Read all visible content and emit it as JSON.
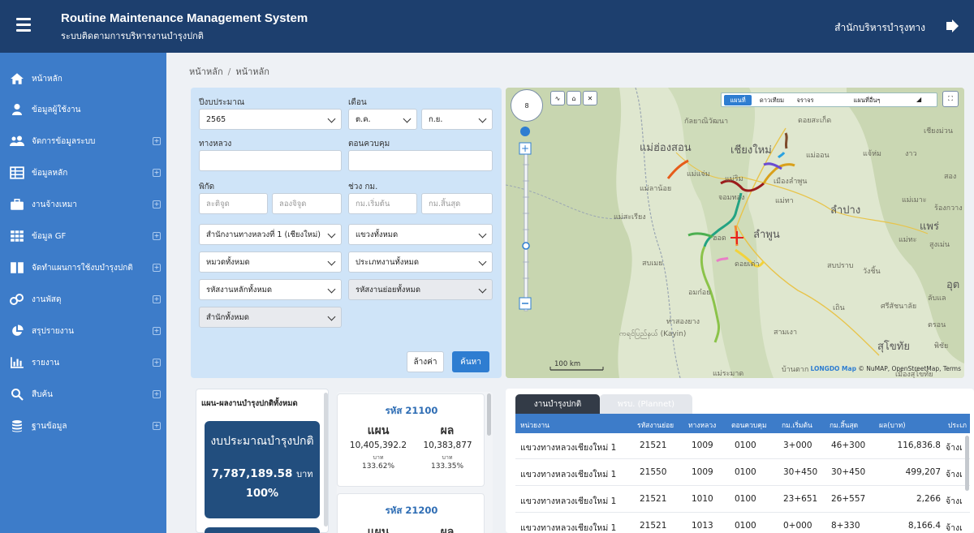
{
  "header": {
    "title": "Routine Maintenance Management System",
    "subtitle": "ระบบติดตามการบริหารงานบำรุงปกติ",
    "org": "สำนักบริหารบำรุงทาง"
  },
  "sidebar": {
    "items": [
      {
        "label": "หน้าหลัก",
        "icon": "home-icon",
        "expandable": false
      },
      {
        "label": "ข้อมูลผู้ใช้งาน",
        "icon": "user-icon",
        "expandable": false
      },
      {
        "label": "จัดการข้อมูลระบบ",
        "icon": "users-icon",
        "expandable": true
      },
      {
        "label": "ข้อมูลหลัก",
        "icon": "table-icon",
        "expandable": true
      },
      {
        "label": "งานจ้างเหมา",
        "icon": "briefcase-icon",
        "expandable": true
      },
      {
        "label": "ข้อมูล GF",
        "icon": "grid-icon",
        "expandable": true
      },
      {
        "label": "จัดทำแผนการใช้งบบำรุงปกติ",
        "icon": "columns-icon",
        "expandable": true
      },
      {
        "label": "งานพัสดุ",
        "icon": "cubes-icon",
        "expandable": true
      },
      {
        "label": "สรุปรายงาน",
        "icon": "pie-chart-icon",
        "expandable": true
      },
      {
        "label": "รายงาน",
        "icon": "bar-chart-icon",
        "expandable": true
      },
      {
        "label": "สืบค้น",
        "icon": "search-icon",
        "expandable": true
      },
      {
        "label": "ฐานข้อมูล",
        "icon": "database-icon",
        "expandable": true
      }
    ]
  },
  "breadcrumb": {
    "items": [
      "หน้าหลัก",
      "หน้าหลัก"
    ],
    "separator": "/"
  },
  "filters": {
    "fiscal_year_label": "ปีงบประมาณ",
    "fiscal_year_value": "2565",
    "month_label": "เดือน",
    "month_from": "ต.ค.",
    "month_to": "ก.ย.",
    "highway_label": "ทางหลวง",
    "highway_value": "",
    "control_label": "ตอนควบคุม",
    "control_value": "",
    "coord_label": "พิกัด",
    "lat_placeholder": "ละติจูด",
    "lon_placeholder": "ลองจิจูด",
    "km_label": "ช่วง กม.",
    "km_start_placeholder": "กม.เริ่มต้น",
    "km_end_placeholder": "กม.สิ้นสุด",
    "bureau": "สำนักงานทางหลวงที่ 1 (เชียงใหม่)",
    "district": "แขวงทั้งหมด",
    "unit": "หมวดทั้งหมด",
    "work_type": "ประเภทงานทั้งหมด",
    "main_code": "รหัสงานหลักทั้งหมด",
    "sub_code": "รหัสงานย่อยทั้งหมด",
    "office": "สำนักทั้งหมด",
    "clear_label": "ล้างค่า",
    "search_label": "ค้นหา"
  },
  "map": {
    "zoom_level": "8",
    "types": [
      "แผนที่",
      "ดาวเทียม",
      "จราจร",
      "แผนที่อื่นๆ"
    ],
    "active_type": "แผนที่",
    "scale": "100 km",
    "attribution_brand": "LONGDO Map",
    "attribution_rest": "© NuMAP, OpenStreetMap, Terms",
    "labels": [
      {
        "text": "กัลยาณิวัฒนา"
      },
      {
        "text": "ดอยสะเก็ด"
      },
      {
        "text": "เชียงม่วน"
      },
      {
        "text": "แม่ฮ่องสอน",
        "big": true
      },
      {
        "text": "เชียงใหม่",
        "big": true
      },
      {
        "text": "แม่ออน"
      },
      {
        "text": "แจ้ห่ม"
      },
      {
        "text": "งาว"
      },
      {
        "text": "แม่แจ่ม"
      },
      {
        "text": "เมืองลำพูน"
      },
      {
        "text": "สอง"
      },
      {
        "text": "แม่ลาน้อย"
      },
      {
        "text": "จอมทอง"
      },
      {
        "text": "แม่ทา"
      },
      {
        "text": "ลำปาง",
        "big": true
      },
      {
        "text": "แม่เมาะ"
      },
      {
        "text": "ร้องกวาง"
      },
      {
        "text": "แม่สะเรียง"
      },
      {
        "text": "แพร่",
        "big": true
      },
      {
        "text": "ฮอด"
      },
      {
        "text": "ลำพูน",
        "big": true
      },
      {
        "text": "แม่ทะ"
      },
      {
        "text": "สูงเม่น"
      },
      {
        "text": "สบเมย"
      },
      {
        "text": "ดอยเต่า"
      },
      {
        "text": "สบปราบ"
      },
      {
        "text": "วังชิ้น"
      },
      {
        "text": "อุต",
        "big": true
      },
      {
        "text": "อมก๋อย"
      },
      {
        "text": "เถิน"
      },
      {
        "text": "ศรีสัชนาลัย"
      },
      {
        "text": "ลับแล"
      },
      {
        "text": "ท่าสองยาง"
      },
      {
        "text": "สามเงา"
      },
      {
        "text": "ตรอน"
      },
      {
        "text": "ကရင်ပြည်နယ် (Kayin)"
      },
      {
        "text": "สุโขทัย",
        "big": true
      },
      {
        "text": "พิชัย"
      },
      {
        "text": "แม่ระมาด"
      },
      {
        "text": "บ้านตาก"
      },
      {
        "text": "แม่ริม"
      },
      {
        "text": "เมืองสุโขทัย"
      }
    ]
  },
  "summary": {
    "title": "แผน-ผลงานบำรุงปกติทั้งหมด",
    "budget_title": "งบประมาณบำรุงปกติ",
    "budget_amount": "7,787,189.58",
    "budget_unit": "บาท",
    "budget_pct": "100%"
  },
  "codes": [
    {
      "title": "รหัส 21100",
      "plan_label": "แผน",
      "result_label": "ผล",
      "plan_value": "10,405,392.2",
      "result_value": "10,383,877",
      "unit": "บาท",
      "plan_pct": "133.62%",
      "result_pct": "133.35%"
    },
    {
      "title": "รหัส 21200",
      "plan_label": "แผน",
      "result_label": "ผล"
    }
  ],
  "table": {
    "tabs": [
      "งานบำรุงปกติ",
      "พรบ. (Plannet)"
    ],
    "columns": [
      "หน่วยงาน",
      "รหัสงานย่อย",
      "ทางหลวง",
      "ตอนควบคุม",
      "กม.เริ่มต้น",
      "กม.สิ้นสุด",
      "ผล(บาท)",
      "ประเภ"
    ],
    "rows": [
      [
        "แขวงทางหลวงเชียงใหม่ 1",
        "21521",
        "1009",
        "0100",
        "3+000",
        "46+300",
        "116,836.8",
        "จ้างเ"
      ],
      [
        "แขวงทางหลวงเชียงใหม่ 1",
        "21550",
        "1009",
        "0100",
        "30+450",
        "30+450",
        "499,207",
        "จ้างเ"
      ],
      [
        "แขวงทางหลวงเชียงใหม่ 1",
        "21521",
        "1010",
        "0100",
        "23+651",
        "26+557",
        "2,266",
        "จ้างเ"
      ],
      [
        "แขวงทางหลวงเชียงใหม่ 1",
        "21521",
        "1013",
        "0100",
        "0+000",
        "8+330",
        "8,166.4",
        "จ้างเ"
      ]
    ]
  },
  "colors": {
    "header": "#1d3f6e",
    "sidebar": "#3d7cc9",
    "accent": "#2e7dd1",
    "filter_bg": "#cfe4f8",
    "budget_card": "#224e7e"
  }
}
